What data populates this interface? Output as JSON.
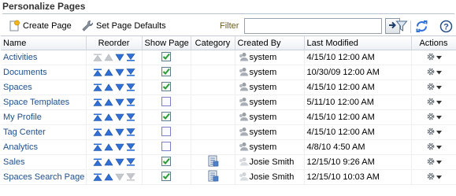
{
  "header": {
    "title": "Personalize Pages"
  },
  "toolbar": {
    "create_label": "Create Page",
    "defaults_label": "Set Page Defaults",
    "filter_label": "Filter",
    "filter_value": ""
  },
  "table": {
    "columns": {
      "name": "Name",
      "reorder": "Reorder",
      "show": "Show Page",
      "category": "Category",
      "created_by": "Created By",
      "modified": "Last Modified",
      "actions": "Actions"
    },
    "rows": [
      {
        "name": "Activities",
        "reorder": [
          false,
          false,
          true,
          true
        ],
        "shown": true,
        "category": false,
        "created_by": "system",
        "modified": "4/15/10 12:00 AM"
      },
      {
        "name": "Documents",
        "reorder": [
          true,
          true,
          true,
          true
        ],
        "shown": true,
        "category": false,
        "created_by": "system",
        "modified": "10/30/09 12:00 AM"
      },
      {
        "name": "Spaces",
        "reorder": [
          true,
          true,
          true,
          true
        ],
        "shown": true,
        "category": false,
        "created_by": "system",
        "modified": "4/15/10 12:00 AM"
      },
      {
        "name": "Space Templates",
        "reorder": [
          true,
          true,
          true,
          true
        ],
        "shown": false,
        "category": false,
        "created_by": "system",
        "modified": "5/11/10 12:00 AM"
      },
      {
        "name": "My Profile",
        "reorder": [
          true,
          true,
          true,
          true
        ],
        "shown": true,
        "category": false,
        "created_by": "system",
        "modified": "4/15/10 12:00 AM"
      },
      {
        "name": "Tag Center",
        "reorder": [
          true,
          true,
          true,
          true
        ],
        "shown": false,
        "category": false,
        "created_by": "system",
        "modified": "4/15/10 12:00 AM"
      },
      {
        "name": "Analytics",
        "reorder": [
          true,
          true,
          true,
          true
        ],
        "shown": false,
        "category": false,
        "created_by": "system",
        "modified": "4/8/10 4:50 AM"
      },
      {
        "name": "Sales",
        "reorder": [
          true,
          true,
          true,
          true
        ],
        "shown": true,
        "category": true,
        "created_by": "Josie Smith",
        "modified": "12/15/10 9:26 AM"
      },
      {
        "name": "Spaces Search Page",
        "reorder": [
          true,
          true,
          false,
          false
        ],
        "shown": true,
        "category": true,
        "created_by": "Josie Smith",
        "modified": "12/15/10 10:03 AM"
      }
    ]
  },
  "colors": {
    "link": "#1e4f8c",
    "arrow_active": "#2f6fd6",
    "arrow_disabled": "#c4c7cc",
    "check": "#2e9a3a"
  }
}
